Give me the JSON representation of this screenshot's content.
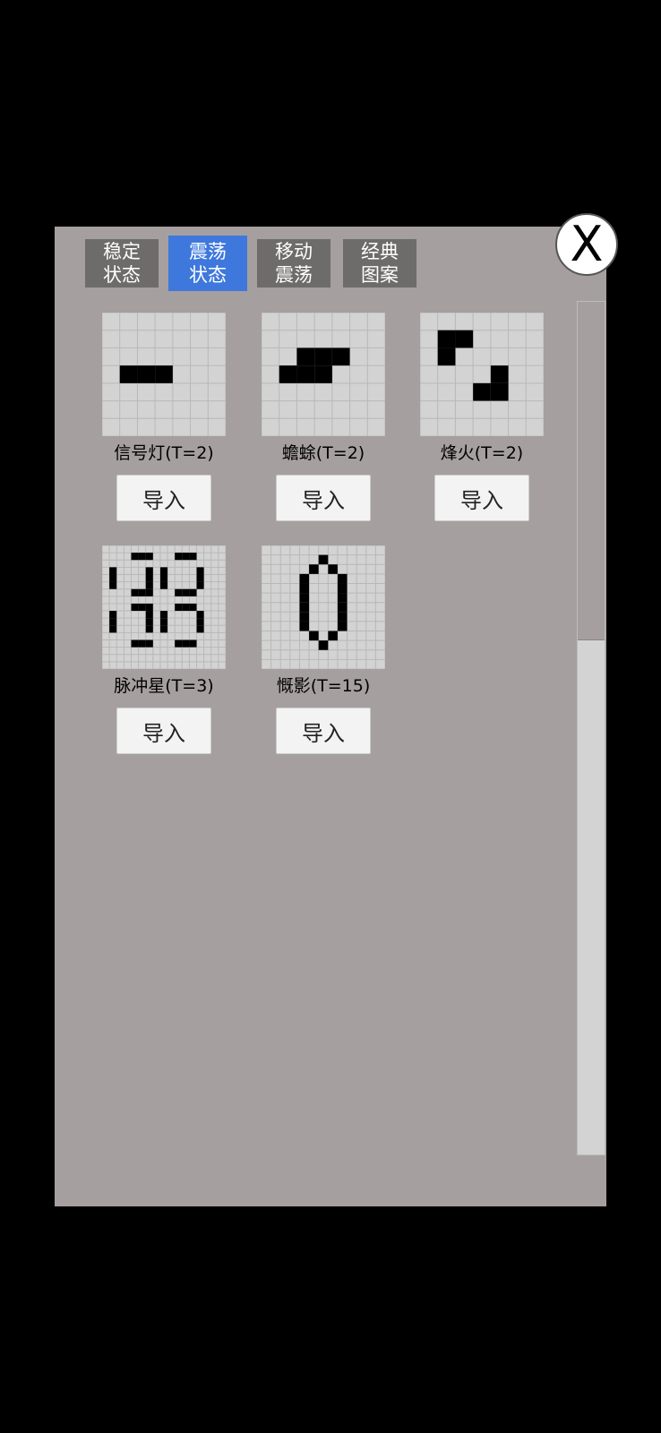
{
  "close": {
    "label": "X"
  },
  "tabs": [
    {
      "label": "稳定\n状态",
      "active": false
    },
    {
      "label": "震荡\n状态",
      "active": true
    },
    {
      "label": "移动\n震荡",
      "active": false
    },
    {
      "label": "经典\n图案",
      "active": false
    }
  ],
  "patterns": [
    {
      "label": "信号灯(T=2)",
      "button": "导入",
      "grid_size": 7,
      "cells": [
        [
          1,
          3
        ],
        [
          2,
          3
        ],
        [
          3,
          3
        ]
      ]
    },
    {
      "label": "蟾蜍(T=2)",
      "button": "导入",
      "grid_size": 7,
      "cells": [
        [
          2,
          2
        ],
        [
          3,
          2
        ],
        [
          4,
          2
        ],
        [
          1,
          3
        ],
        [
          2,
          3
        ],
        [
          3,
          3
        ]
      ]
    },
    {
      "label": "烽火(T=2)",
      "button": "导入",
      "grid_size": 7,
      "cells": [
        [
          1,
          1
        ],
        [
          2,
          1
        ],
        [
          1,
          2
        ],
        [
          4,
          3
        ],
        [
          3,
          4
        ],
        [
          4,
          4
        ]
      ]
    },
    {
      "label": "脉冲星(T=3)",
      "button": "导入",
      "grid_size": 17,
      "cells": [
        [
          4,
          1
        ],
        [
          5,
          1
        ],
        [
          6,
          1
        ],
        [
          10,
          1
        ],
        [
          11,
          1
        ],
        [
          12,
          1
        ],
        [
          1,
          3
        ],
        [
          8,
          3
        ],
        [
          6,
          3
        ],
        [
          1,
          4
        ],
        [
          6,
          4
        ],
        [
          8,
          4
        ],
        [
          1,
          5
        ],
        [
          6,
          5
        ],
        [
          8,
          5
        ],
        [
          13,
          3
        ],
        [
          13,
          4
        ],
        [
          13,
          5
        ],
        [
          4,
          6
        ],
        [
          5,
          6
        ],
        [
          6,
          6
        ],
        [
          10,
          6
        ],
        [
          11,
          6
        ],
        [
          12,
          6
        ],
        [
          4,
          8
        ],
        [
          5,
          8
        ],
        [
          6,
          8
        ],
        [
          10,
          8
        ],
        [
          11,
          8
        ],
        [
          12,
          8
        ],
        [
          1,
          9
        ],
        [
          6,
          9
        ],
        [
          8,
          9
        ],
        [
          13,
          9
        ],
        [
          1,
          10
        ],
        [
          6,
          10
        ],
        [
          8,
          10
        ],
        [
          13,
          10
        ],
        [
          1,
          11
        ],
        [
          6,
          11
        ],
        [
          8,
          11
        ],
        [
          13,
          11
        ],
        [
          4,
          13
        ],
        [
          5,
          13
        ],
        [
          6,
          13
        ],
        [
          10,
          13
        ],
        [
          11,
          13
        ],
        [
          12,
          13
        ]
      ]
    },
    {
      "label": "慨影(T=15)",
      "button": "导入",
      "grid_size": 13,
      "cells": [
        [
          6,
          1
        ],
        [
          5,
          2
        ],
        [
          7,
          2
        ],
        [
          4,
          3
        ],
        [
          8,
          3
        ],
        [
          4,
          4
        ],
        [
          8,
          4
        ],
        [
          4,
          5
        ],
        [
          8,
          5
        ],
        [
          4,
          6
        ],
        [
          8,
          6
        ],
        [
          4,
          7
        ],
        [
          8,
          7
        ],
        [
          4,
          8
        ],
        [
          8,
          8
        ],
        [
          5,
          9
        ],
        [
          7,
          9
        ],
        [
          6,
          10
        ]
      ]
    }
  ]
}
